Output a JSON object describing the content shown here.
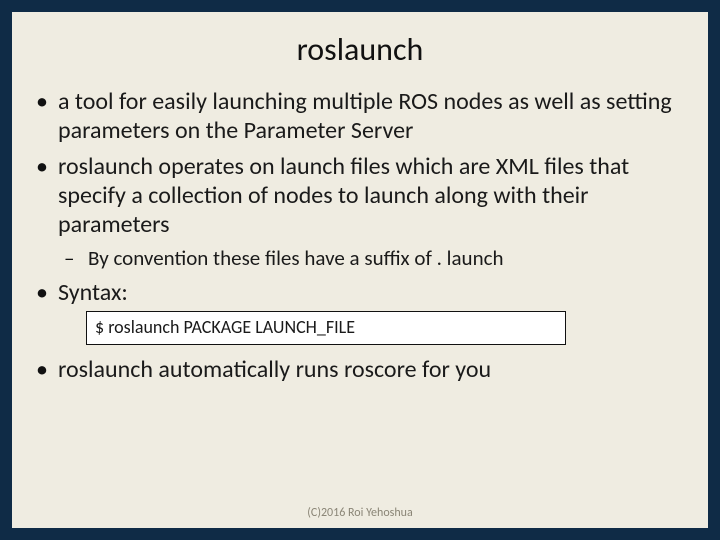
{
  "title": "roslaunch",
  "bullets": {
    "b0": "a tool for easily launching multiple ROS nodes as well as setting parameters on the Parameter Server",
    "b1": "roslaunch operates on launch files which are XML files that specify a collection of nodes to launch along with their parameters",
    "b1_sub0": "By convention these files have a suffix of . launch",
    "b2": "Syntax:",
    "b2_code": "$ roslaunch PACKAGE LAUNCH_FILE",
    "b3": "roslaunch automatically runs roscore for you"
  },
  "footer": "(C)2016 Roi Yehoshua"
}
